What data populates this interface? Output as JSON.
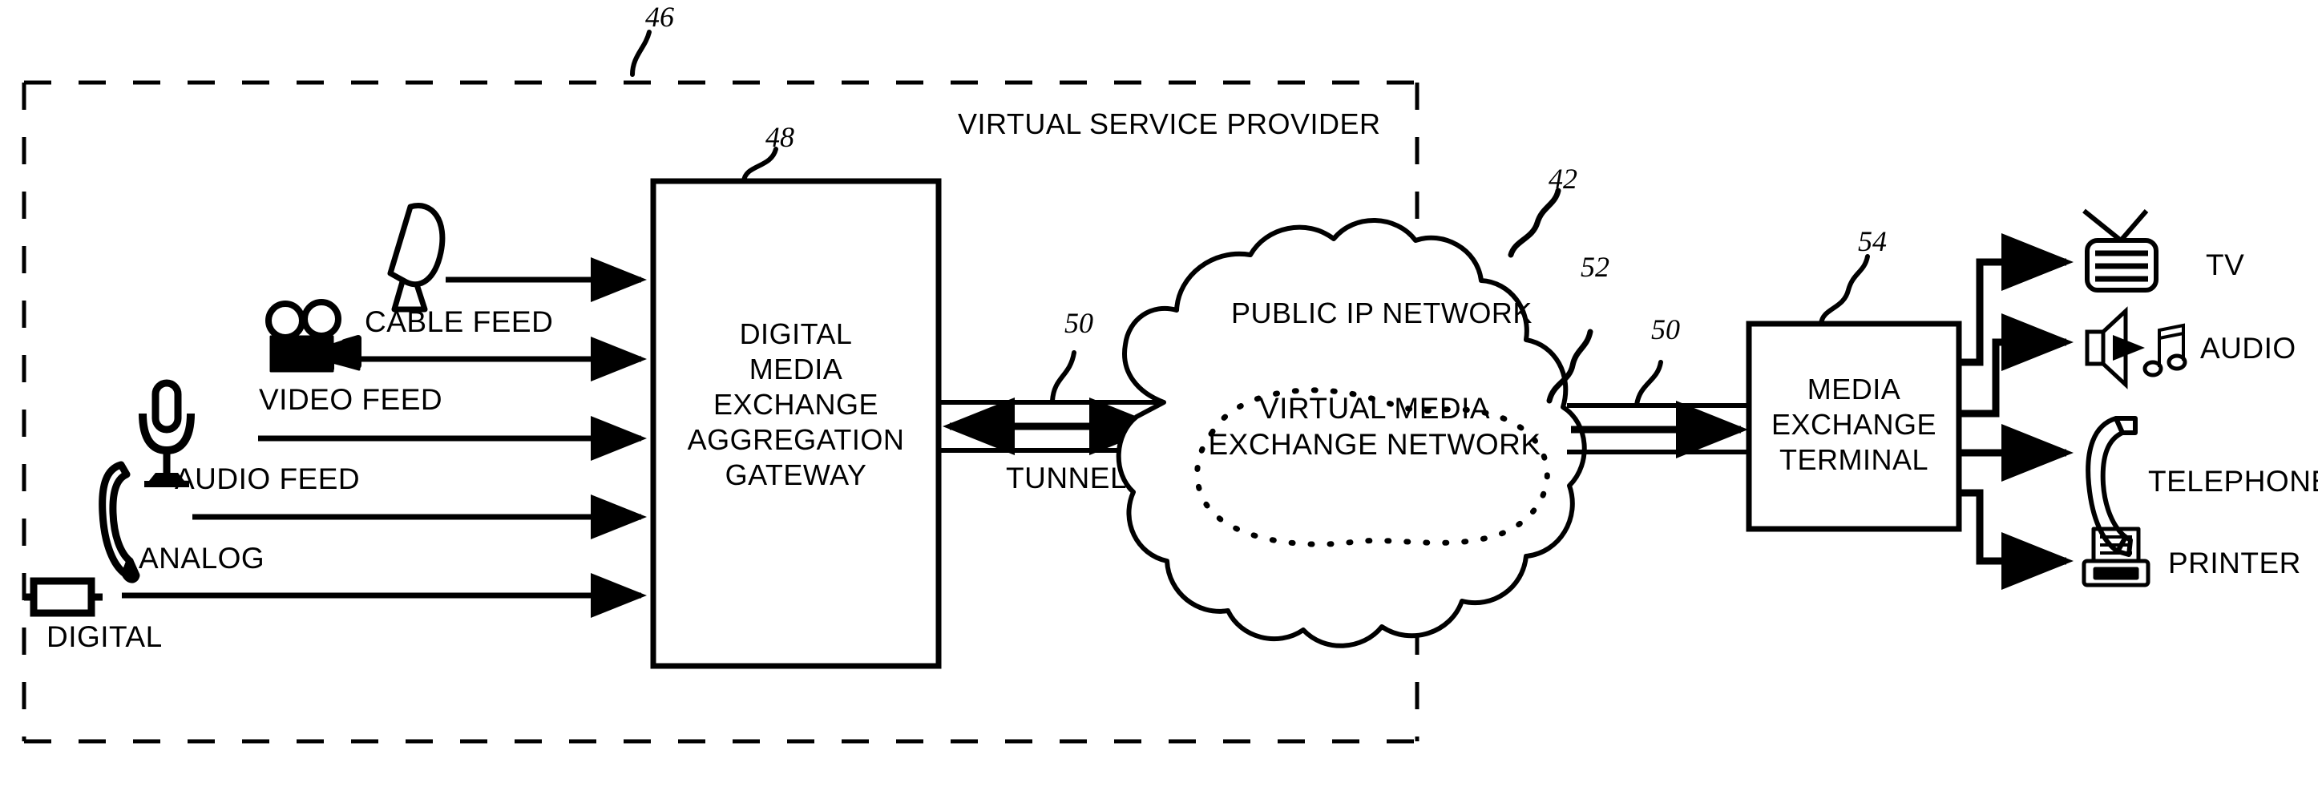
{
  "diagram": {
    "type": "patent-block-diagram",
    "boundary": {
      "label": "VIRTUAL SERVICE PROVIDER",
      "ref": "46",
      "style": "dashed"
    },
    "inputs": [
      {
        "icon": "satellite-dish-icon",
        "label": "CABLE FEED"
      },
      {
        "icon": "video-camera-icon",
        "label": "VIDEO FEED"
      },
      {
        "icon": "microphone-icon",
        "label": "AUDIO FEED"
      },
      {
        "icon": "telephone-handset-icon",
        "label": "ANALOG"
      },
      {
        "icon": "resistor-icon",
        "label": "DIGITAL"
      }
    ],
    "gateway": {
      "ref": "48",
      "lines": [
        "DIGITAL",
        "MEDIA",
        "EXCHANGE",
        "AGGREGATION",
        "GATEWAY"
      ]
    },
    "tunnel_left": {
      "label": "TUNNEL",
      "ref": "50",
      "arrow": "bidirectional"
    },
    "tunnel_right": {
      "label": "",
      "ref": "50",
      "arrow": "right"
    },
    "cloud": {
      "ref": "42",
      "label": "PUBLIC  IP NETWORK",
      "inner": {
        "ref": "52",
        "lines": [
          "VIRTUAL MEDIA",
          "EXCHANGE NETWORK"
        ],
        "style": "dotted"
      }
    },
    "terminal": {
      "ref": "54",
      "lines": [
        "MEDIA",
        "EXCHANGE",
        "TERMINAL"
      ]
    },
    "outputs": [
      {
        "icon": "tv-icon",
        "label": "TV"
      },
      {
        "icon": "speaker-music-icon",
        "label": "AUDIO"
      },
      {
        "icon": "telephone-handset-icon",
        "label": "TELEPHONE"
      },
      {
        "icon": "printer-icon",
        "label": "PRINTER"
      }
    ],
    "colors": {
      "ink": "#000000",
      "paper": "#ffffff"
    }
  }
}
